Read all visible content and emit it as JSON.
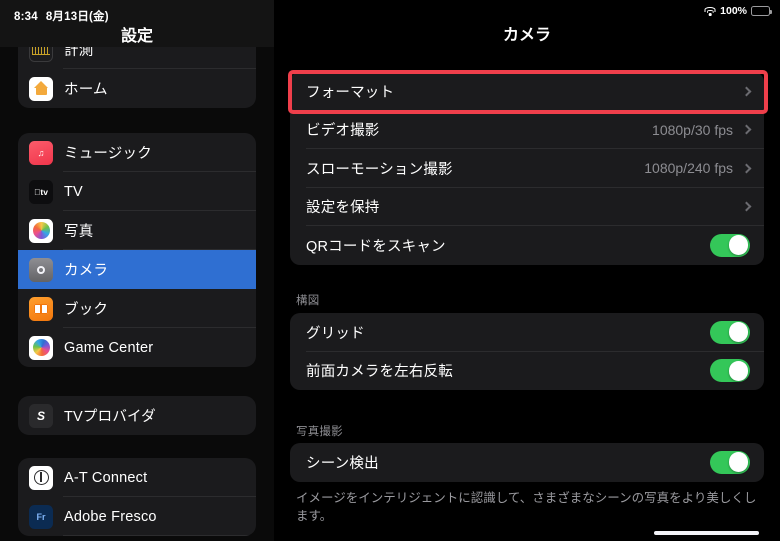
{
  "status_bar": {
    "time": "8:34",
    "date": "8月13日(金)",
    "wifi_icon": "wifi-icon",
    "battery_percent": "100%",
    "battery_icon": "battery-full-icon"
  },
  "sidebar": {
    "title": "設定",
    "groups": [
      {
        "items": [
          {
            "label": "計測",
            "icon": "measure-icon",
            "selected": false
          },
          {
            "label": "ホーム",
            "icon": "home-icon",
            "selected": false
          }
        ]
      },
      {
        "items": [
          {
            "label": "ミュージック",
            "icon": "music-icon",
            "selected": false
          },
          {
            "label": "TV",
            "icon": "tv-icon",
            "selected": false
          },
          {
            "label": "写真",
            "icon": "photos-icon",
            "selected": false
          },
          {
            "label": "カメラ",
            "icon": "camera-icon",
            "selected": true
          },
          {
            "label": "ブック",
            "icon": "books-icon",
            "selected": false
          },
          {
            "label": "Game Center",
            "icon": "game-center-icon",
            "selected": false
          }
        ]
      },
      {
        "items": [
          {
            "label": "TVプロバイダ",
            "icon": "tv-provider-icon",
            "selected": false
          }
        ]
      },
      {
        "items": [
          {
            "label": "A-T Connect",
            "icon": "at-connect-icon",
            "selected": false
          },
          {
            "label": "Adobe Fresco",
            "icon": "adobe-fresco-icon",
            "selected": false
          }
        ]
      }
    ]
  },
  "detail": {
    "title": "カメラ",
    "highlighted_row": "フォーマット",
    "group1": {
      "rows": [
        {
          "label": "フォーマット",
          "value": "",
          "type": "disclosure",
          "highlighted": true
        },
        {
          "label": "ビデオ撮影",
          "value": "1080p/30 fps",
          "type": "disclosure"
        },
        {
          "label": "スローモーション撮影",
          "value": "1080p/240 fps",
          "type": "disclosure"
        },
        {
          "label": "設定を保持",
          "value": "",
          "type": "disclosure"
        },
        {
          "label": "QRコードをスキャン",
          "value": "",
          "type": "toggle",
          "toggle_on": true
        }
      ]
    },
    "group2": {
      "header": "構図",
      "rows": [
        {
          "label": "グリッド",
          "type": "toggle",
          "toggle_on": true
        },
        {
          "label": "前面カメラを左右反転",
          "type": "toggle",
          "toggle_on": true
        }
      ]
    },
    "group3": {
      "header": "写真撮影",
      "rows": [
        {
          "label": "シーン検出",
          "type": "toggle",
          "toggle_on": true
        }
      ],
      "footnote": "イメージをインテリジェントに認識して、さまざまなシーンの写真をより美しくします。"
    }
  },
  "colors": {
    "selection_blue": "#2f6fd2",
    "toggle_green": "#34c759",
    "highlight_red": "#ef3f4b",
    "card_background": "#1b1b1d"
  }
}
